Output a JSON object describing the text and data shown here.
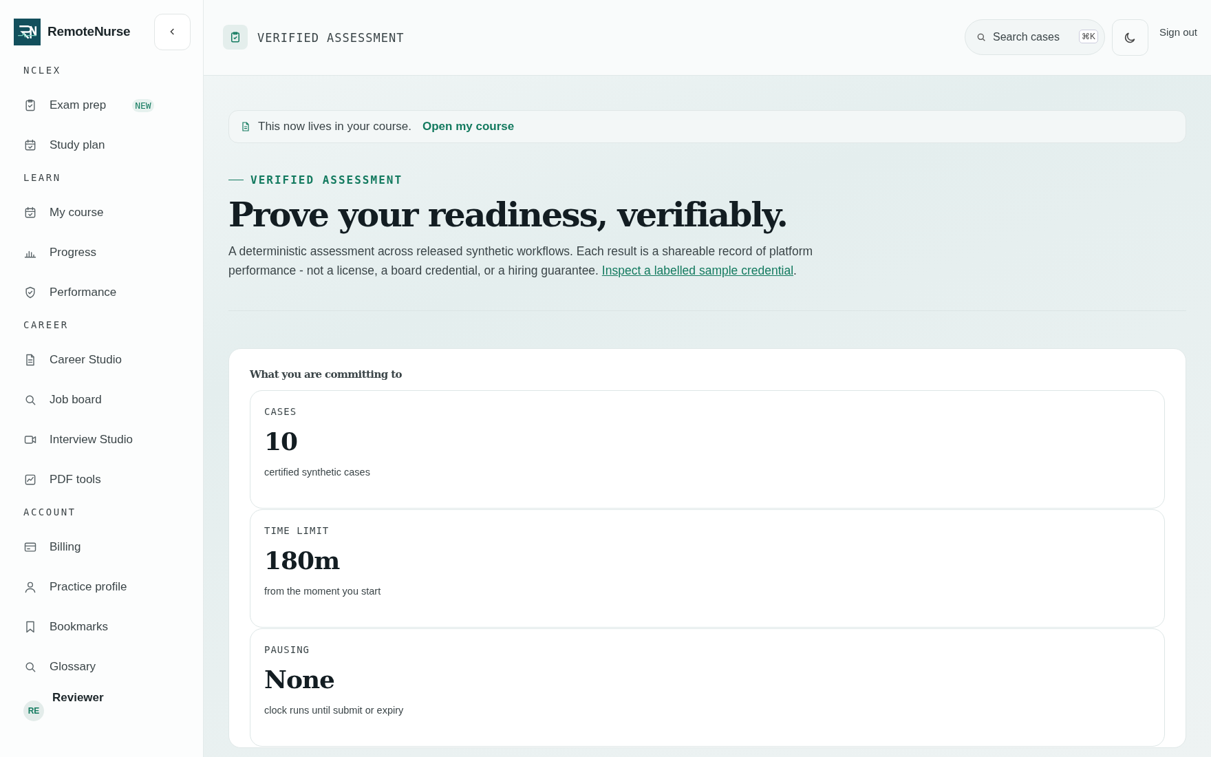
{
  "brand": {
    "name": "RemoteNurse"
  },
  "sidebar": {
    "sections": [
      {
        "title": "NCLEX",
        "items": [
          {
            "label": "Exam prep",
            "kind": "clipboard",
            "badge": "NEW"
          },
          {
            "label": "Study plan",
            "kind": "calendar"
          }
        ]
      },
      {
        "title": "LEARN",
        "items": [
          {
            "label": "My course",
            "kind": "calendar"
          },
          {
            "label": "Progress",
            "kind": "bars"
          },
          {
            "label": "Performance",
            "kind": "shield"
          }
        ]
      },
      {
        "title": "CAREER",
        "items": [
          {
            "label": "Career Studio",
            "kind": "file"
          },
          {
            "label": "Job board",
            "kind": "search"
          },
          {
            "label": "Interview Studio",
            "kind": "video"
          },
          {
            "label": "PDF tools",
            "kind": "chart"
          }
        ]
      },
      {
        "title": "ACCOUNT",
        "items": [
          {
            "label": "Billing",
            "kind": "card"
          },
          {
            "label": "Practice profile",
            "kind": "user"
          },
          {
            "label": "Bookmarks",
            "kind": "bookmark"
          },
          {
            "label": "Glossary",
            "kind": "search"
          }
        ]
      }
    ],
    "user": {
      "initials": "RE",
      "name": "Reviewer"
    }
  },
  "header": {
    "title": "VERIFIED ASSESSMENT",
    "search": {
      "placeholder": "Search cases",
      "shortcut": "⌘K"
    },
    "sign_out": "Sign out"
  },
  "banner": {
    "text": "This now lives in your course.",
    "link": "Open my course"
  },
  "hero": {
    "eyebrow": "VERIFIED ASSESSMENT",
    "title": "Prove your readiness, verifiably.",
    "body": "A deterministic assessment across released synthetic workflows. Each result is a shareable record of platform performance - not a license, a board credential, or a hiring guarantee.",
    "link": "Inspect a labelled sample credential",
    "link_after": "."
  },
  "commitments": {
    "title": "What you are committing to",
    "items": [
      {
        "label": "CASES",
        "value": "10",
        "note": "certified synthetic cases"
      },
      {
        "label": "TIME LIMIT",
        "value": "180m",
        "note": "from the moment you start"
      },
      {
        "label": "PAUSING",
        "value": "None",
        "note": "clock runs until submit or expiry"
      }
    ]
  }
}
